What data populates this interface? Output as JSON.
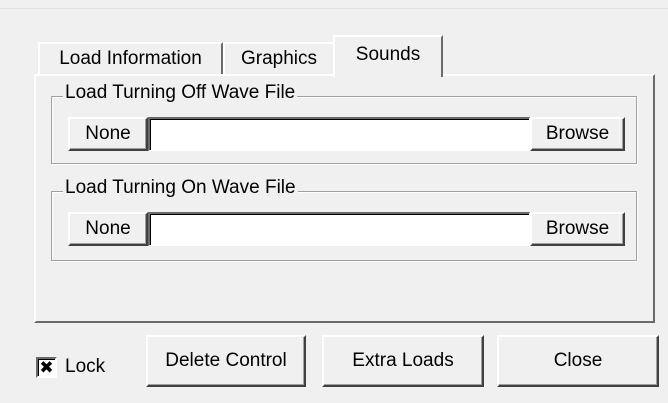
{
  "tabs": [
    {
      "label": "Load Information"
    },
    {
      "label": "Graphics"
    },
    {
      "label": "Sounds",
      "selected": true
    }
  ],
  "sounds": {
    "off_group": {
      "legend": "Load Turning Off Wave File",
      "none_label": "None",
      "value": "",
      "browse_label": "Browse"
    },
    "on_group": {
      "legend": "Load Turning On Wave File",
      "none_label": "None",
      "value": "",
      "browse_label": "Browse"
    }
  },
  "footer": {
    "lock_label": "Lock",
    "lock_checked": true,
    "check_mark": "✖",
    "delete_label": "Delete Control",
    "extra_label": "Extra Loads",
    "close_label": "Close"
  },
  "colors": {
    "face": "#f0f0f0",
    "highlight": "#ffffff",
    "shadow": "#6a6a6a",
    "dark_shadow": "#404040",
    "field": "#ffffff"
  }
}
